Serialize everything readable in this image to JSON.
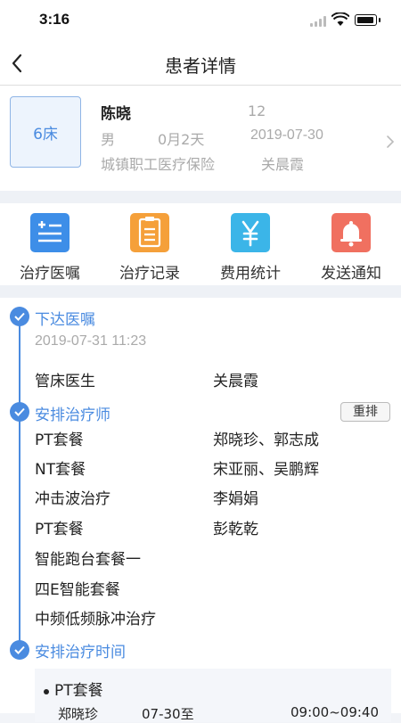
{
  "status_bar": {
    "time": "3:16"
  },
  "nav": {
    "title": "患者详情"
  },
  "patient": {
    "bed": "6床",
    "name": "陈晓",
    "id_number": "12",
    "gender": "男",
    "age": "0月2天",
    "date": "2019-07-30",
    "insurance": "城镇职工医疗保险",
    "doctor": "关晨霞"
  },
  "actions": [
    {
      "label": "治疗医嘱",
      "icon": "add-list-icon",
      "color": "#3d8ee8"
    },
    {
      "label": "治疗记录",
      "icon": "document-icon",
      "color": "#f5a03a"
    },
    {
      "label": "费用统计",
      "icon": "yen-icon",
      "color": "#3bb5e8"
    },
    {
      "label": "发送通知",
      "icon": "bell-icon",
      "color": "#f07060"
    }
  ],
  "timeline": {
    "stage1": {
      "title": "下达医嘱",
      "timestamp": "2019-07-31 11:23",
      "row_label": "管床医生",
      "row_value": "关晨霞"
    },
    "stage2": {
      "title": "安排治疗师",
      "button": "重排",
      "rows": [
        {
          "item": "PT套餐",
          "therapists": "郑晓珍、郭志成"
        },
        {
          "item": "NT套餐",
          "therapists": "宋亚丽、吴鹏辉"
        },
        {
          "item": "冲击波治疗",
          "therapists": "李娟娟"
        },
        {
          "item": "PT套餐",
          "therapists": "彭乾乾"
        },
        {
          "item": "智能跑台套餐一",
          "therapists": ""
        },
        {
          "item": "四E智能套餐",
          "therapists": ""
        },
        {
          "item": "中频低频脉冲治疗",
          "therapists": ""
        }
      ]
    },
    "stage3": {
      "title": "安排治疗时间",
      "schedule": {
        "item": "PT套餐",
        "therapist": "郑晓珍",
        "date_range": "07-30至",
        "time_range": "09:00~09:40"
      }
    }
  },
  "colors": {
    "accent": "#4a8be0"
  }
}
